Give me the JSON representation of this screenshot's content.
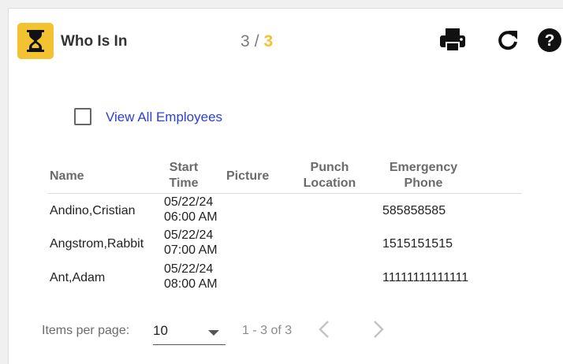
{
  "header": {
    "title": "Who Is In",
    "counter_current": "3",
    "counter_separator": "/",
    "counter_total": "3",
    "icons": [
      "hourglass-icon",
      "print-icon",
      "refresh-icon",
      "help-icon"
    ],
    "accent_color": "#f2c230"
  },
  "filter": {
    "view_all_label": "View All Employees",
    "checked": false
  },
  "table": {
    "columns": {
      "name": "Name",
      "start_time_1": "Start",
      "start_time_2": "Time",
      "picture": "Picture",
      "punch_location_1": "Punch",
      "punch_location_2": "Location",
      "emergency_phone_1": "Emergency",
      "emergency_phone_2": "Phone"
    },
    "rows": [
      {
        "name": "Andino,Cristian",
        "date": "05/22/24",
        "time": "06:00 AM",
        "picture": "",
        "punch_location": "",
        "emergency_phone": "585858585"
      },
      {
        "name": "Angstrom,Rabbit",
        "date": "05/22/24",
        "time": "07:00 AM",
        "picture": "",
        "punch_location": "",
        "emergency_phone": "1515151515"
      },
      {
        "name": "Ant,Adam",
        "date": "05/22/24",
        "time": "08:00 AM",
        "picture": "",
        "punch_location": "",
        "emergency_phone": "11111111111111"
      }
    ]
  },
  "paginator": {
    "items_per_page_label": "Items per page:",
    "items_per_page_value": "10",
    "range_label": "1 - 3 of 3",
    "icons": [
      "chevron-left-icon",
      "chevron-right-icon",
      "chevron-down-icon"
    ]
  }
}
